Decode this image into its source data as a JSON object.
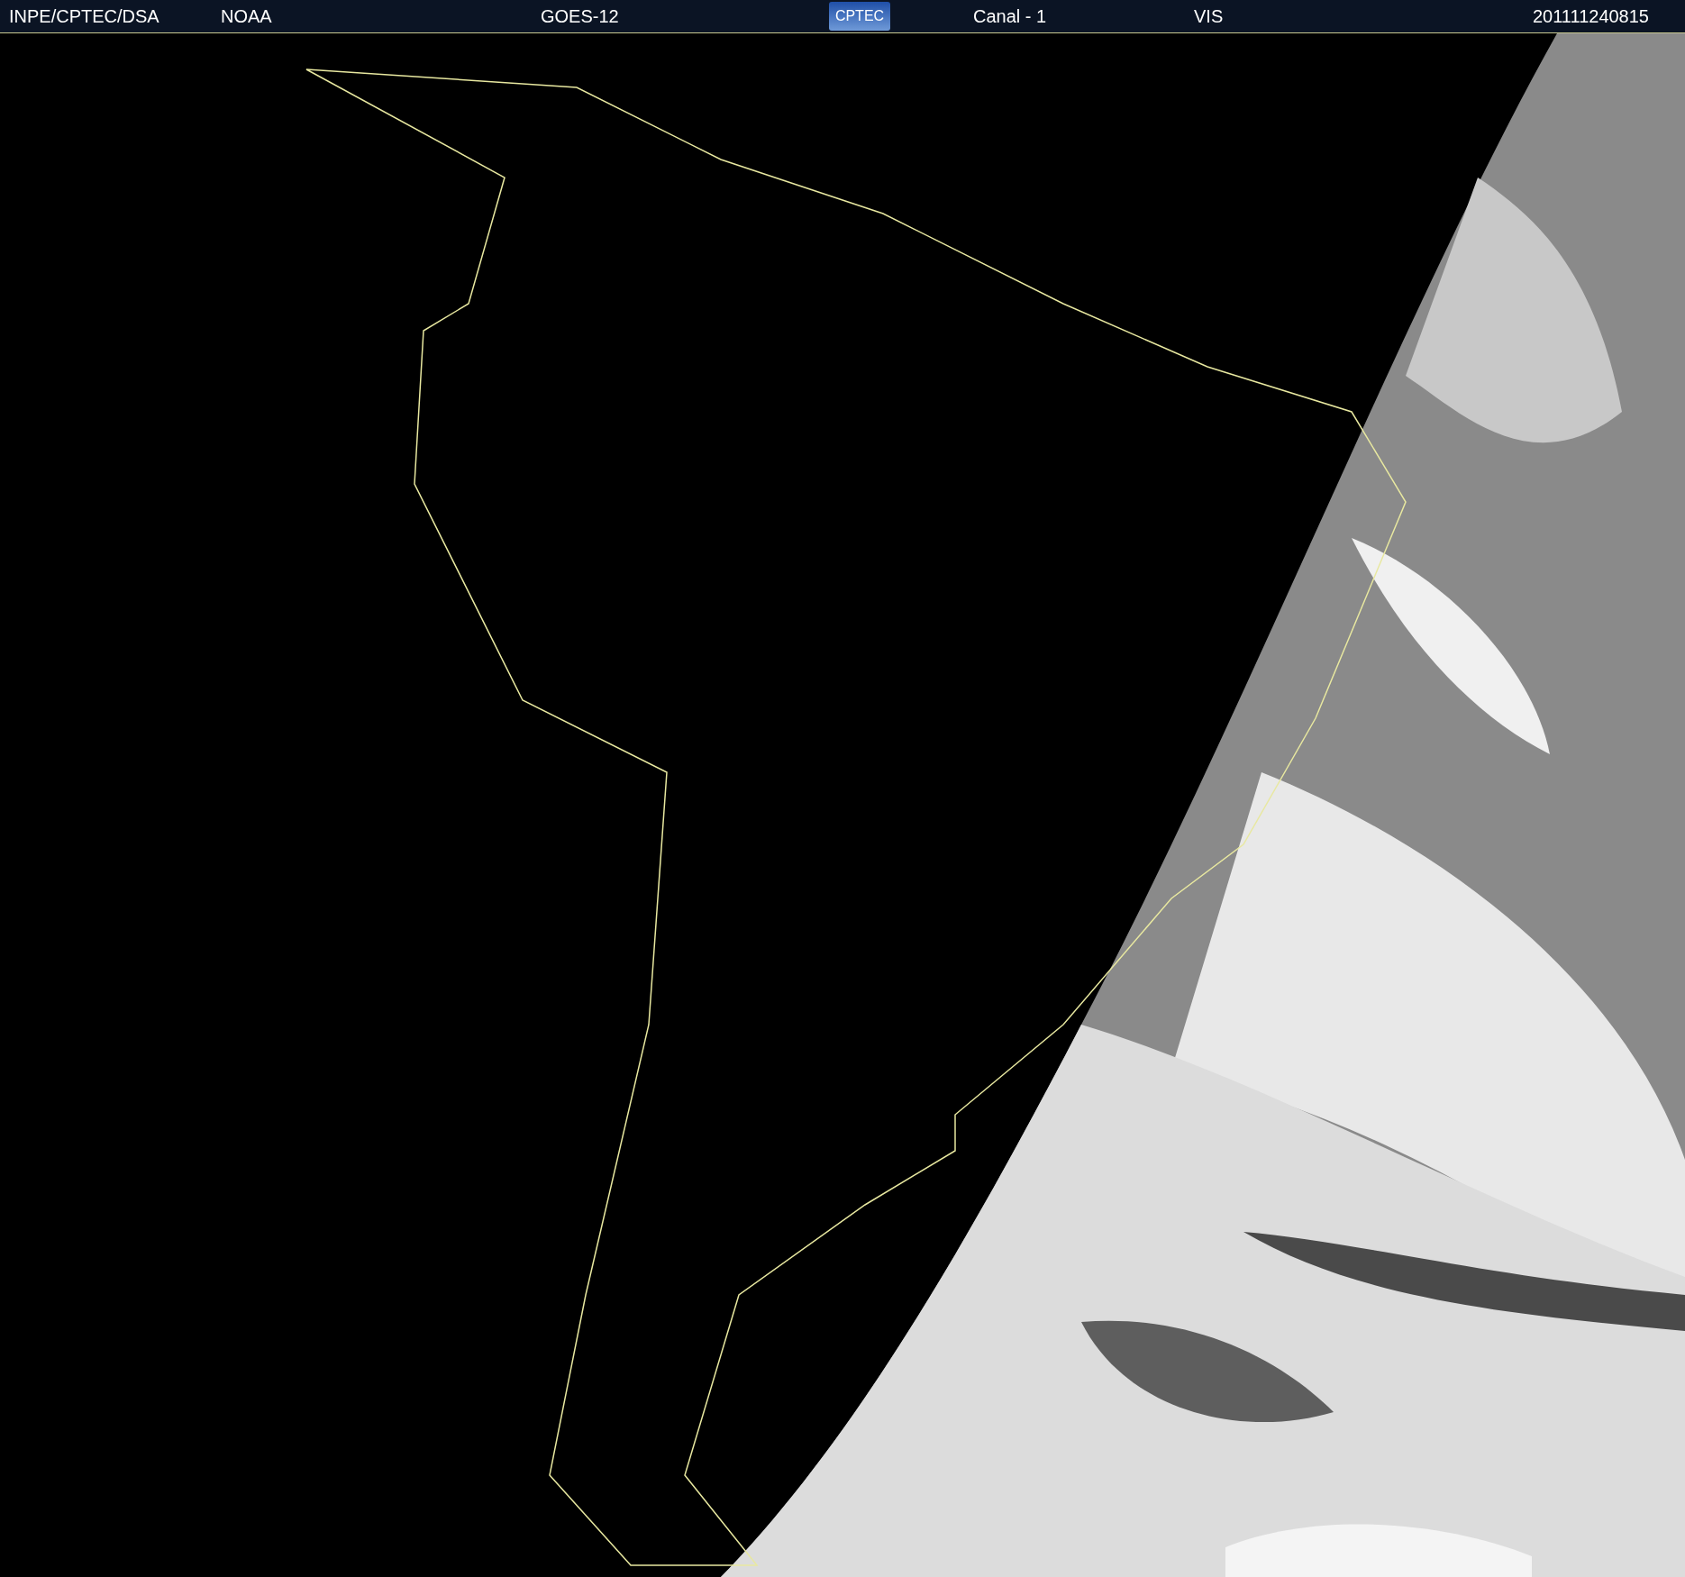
{
  "header": {
    "items": [
      {
        "kind": "text",
        "text": "INPE/CPTEC/DSA"
      },
      {
        "kind": "text",
        "text": "NOAA"
      },
      {
        "kind": "text",
        "text": "GOES-12"
      },
      {
        "kind": "logo",
        "text": "CPTEC"
      },
      {
        "kind": "text",
        "text": "Canal - 1"
      },
      {
        "kind": "text",
        "text": "VIS"
      },
      {
        "kind": "text",
        "text": "201111240815"
      }
    ]
  }
}
